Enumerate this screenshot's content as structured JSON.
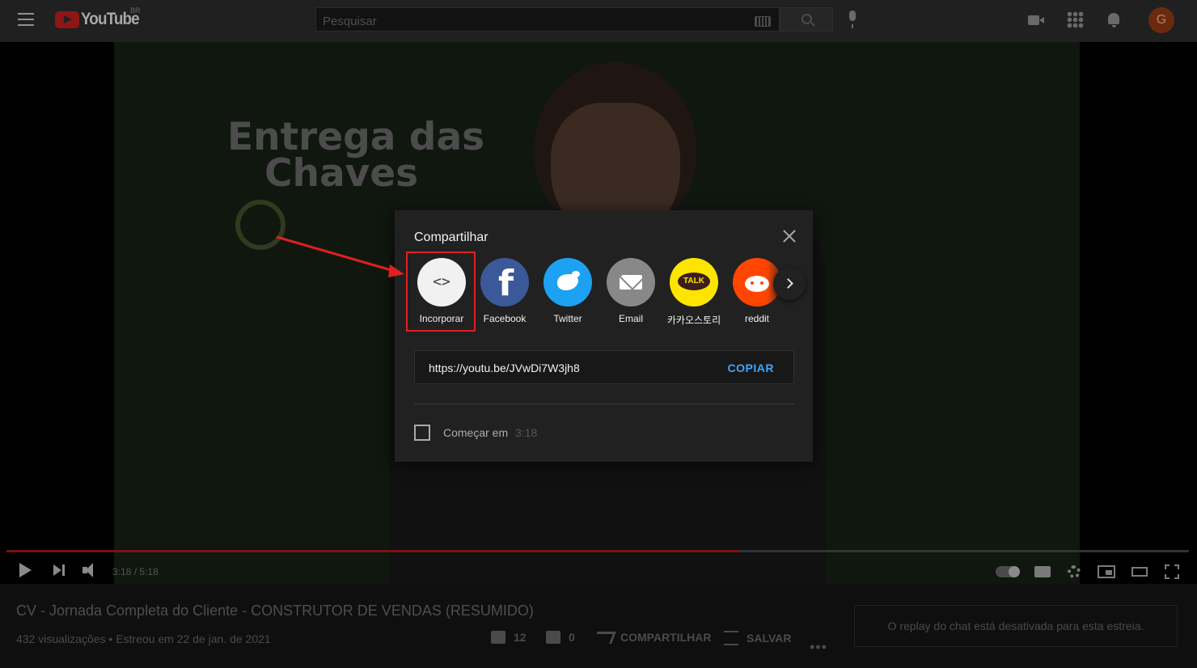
{
  "header": {
    "logo_text": "YouTube",
    "region": "BR",
    "search_placeholder": "Pesquisar",
    "avatar_initial": "G"
  },
  "video_overlay": {
    "line1": "Entrega das",
    "line2": "Chaves"
  },
  "player": {
    "time": "3:18 / 5:18",
    "progress_fraction": 0.62
  },
  "video": {
    "title": "CV - Jornada Completa do Cliente - CONSTRUTOR DE VENDAS (RESUMIDO)",
    "views": "432 visualizações",
    "date": "Estreou em 22 de jan. de 2021",
    "likes": "12",
    "dislikes": "0",
    "share_label": "COMPARTILHAR",
    "save_label": "SALVAR",
    "chat_message": "O replay do chat está desativada para esta estreia."
  },
  "share_dialog": {
    "title": "Compartilhar",
    "targets": [
      {
        "label": "Incorporar",
        "icon": "embed-code-icon"
      },
      {
        "label": "Facebook",
        "icon": "facebook-icon"
      },
      {
        "label": "Twitter",
        "icon": "twitter-icon"
      },
      {
        "label": "Email",
        "icon": "email-icon"
      },
      {
        "label": "카카오스토리",
        "icon": "kakaotalk-icon",
        "icon_text": "TALK"
      },
      {
        "label": "reddit",
        "icon": "reddit-icon"
      }
    ],
    "url": "https://youtu.be/JVwDi7W3jh8",
    "copy_label": "COPIAR",
    "start_label": "Começar em",
    "start_time": "3:18"
  }
}
